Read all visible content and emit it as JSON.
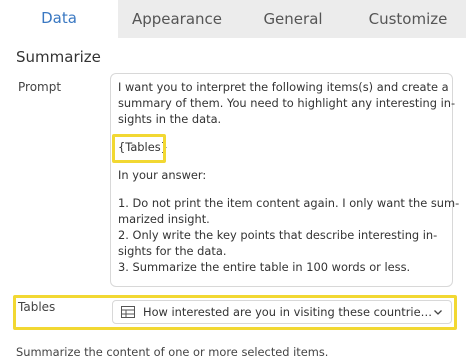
{
  "tabs": [
    {
      "label": "Data",
      "active": true
    },
    {
      "label": "Appearance",
      "active": false
    },
    {
      "label": "General",
      "active": false
    },
    {
      "label": "Customize",
      "active": false
    }
  ],
  "section": {
    "title": "Summarize"
  },
  "prompt": {
    "label": "Prompt",
    "lines": {
      "l1": "I want you to interpret the following items(s) and create a",
      "l2": "summary of them. You need to highlight any interesting in-",
      "l3": "sights in the data.",
      "token": "{Tables}",
      "l5": "In your answer:",
      "l7": "1. Do not print the item content again. I only want the sum-",
      "l8": "marized insight.",
      "l9": "2. Only write the key points that describe interesting in-",
      "l10": "sights for the data.",
      "l11": "3. Summarize the entire table in 100 words or less."
    }
  },
  "tables": {
    "label": "Tables",
    "selected": "How interested are you in visiting these countries in the next year?",
    "icon": "table-icon"
  },
  "footer": {
    "text": "Summarize the content of one or more selected items."
  },
  "colors": {
    "accent": "#3a78c2",
    "highlight": "#f2d832",
    "tab_bg": "#ececec"
  }
}
